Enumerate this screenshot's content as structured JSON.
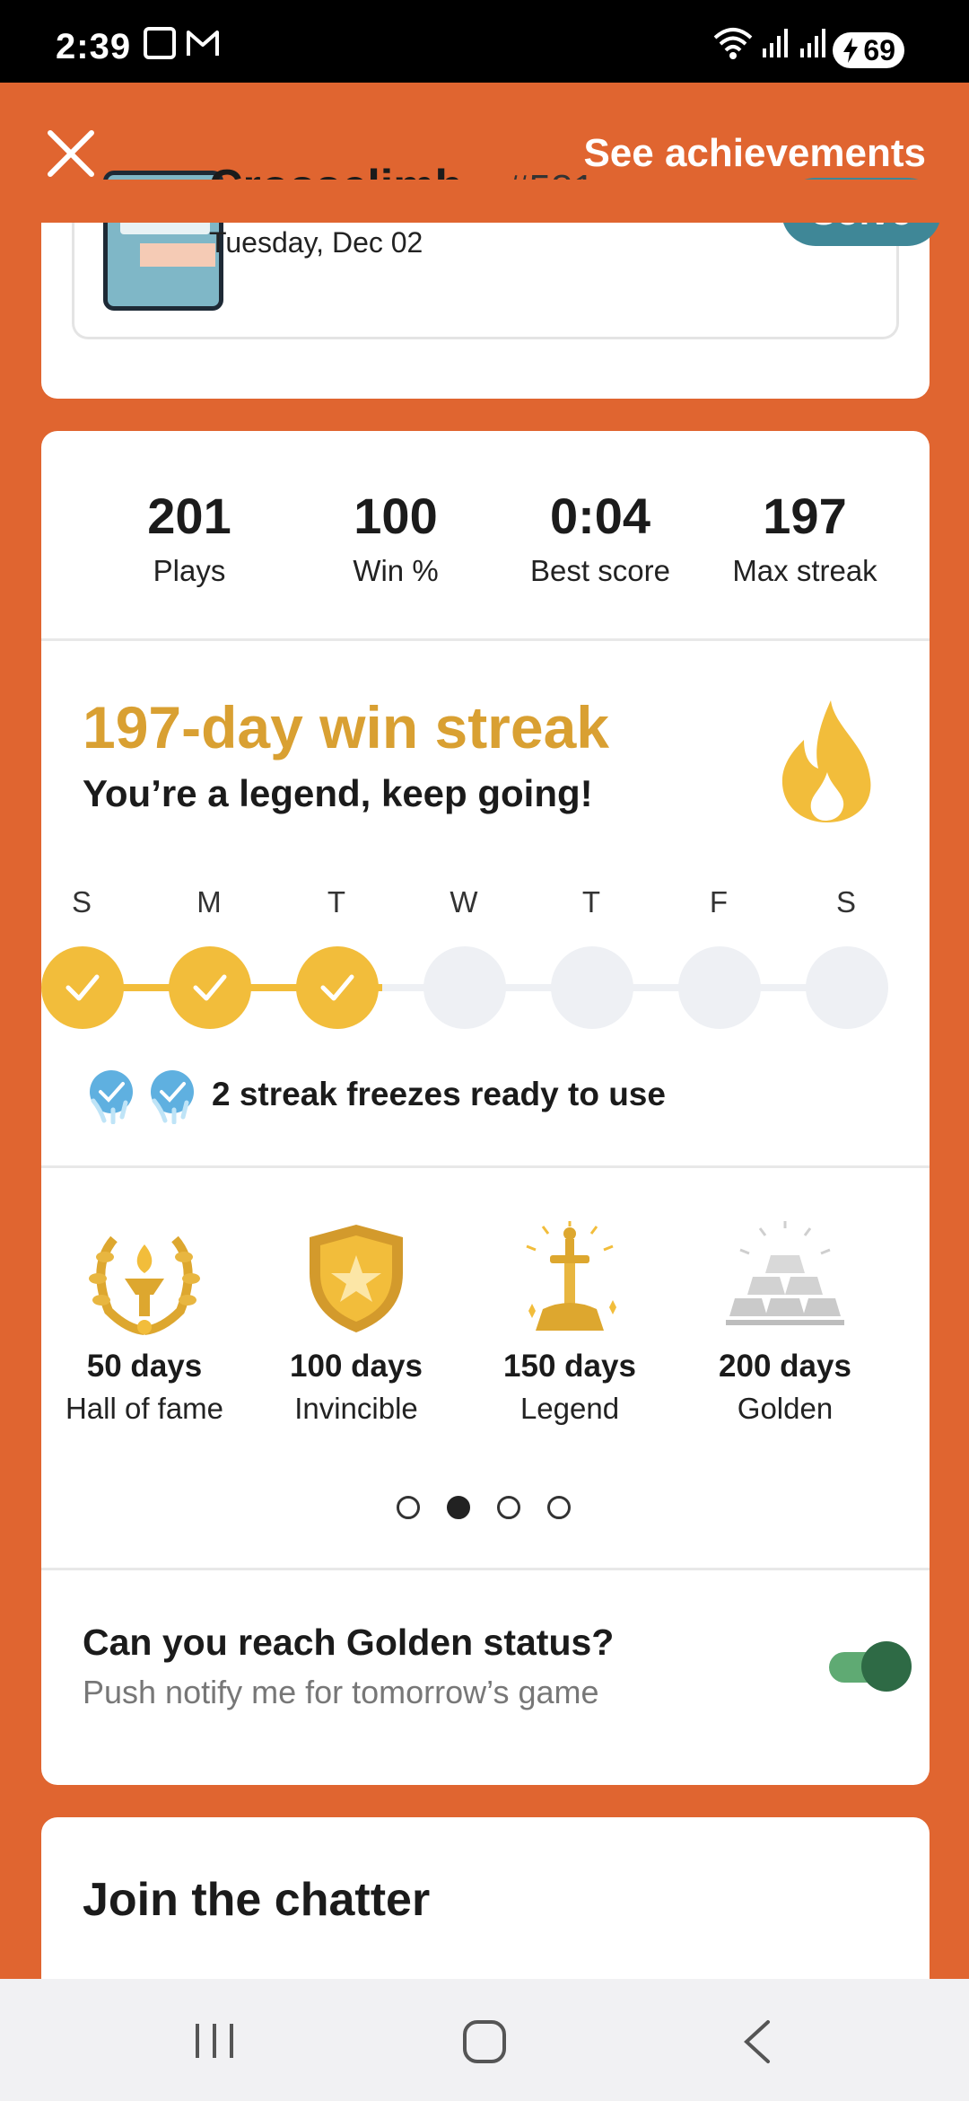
{
  "status_bar": {
    "time": "2:39",
    "battery": "69"
  },
  "header": {
    "see_achievements": "See achievements"
  },
  "puzzle": {
    "name": "Crossclimb",
    "number": "#581",
    "date": "Tuesday, Dec 02",
    "solve_label": "Solve"
  },
  "stats": [
    {
      "value": "201",
      "label": "Plays"
    },
    {
      "value": "100",
      "label": "Win %"
    },
    {
      "value": "0:04",
      "label": "Best score"
    },
    {
      "value": "197",
      "label": "Max streak"
    }
  ],
  "streak": {
    "title": "197-day win streak",
    "subtitle": "You’re a legend, keep going!",
    "days": [
      {
        "letter": "S",
        "done": true
      },
      {
        "letter": "M",
        "done": true
      },
      {
        "letter": "T",
        "done": true
      },
      {
        "letter": "W",
        "done": false
      },
      {
        "letter": "T",
        "done": false
      },
      {
        "letter": "F",
        "done": false
      },
      {
        "letter": "S",
        "done": false
      }
    ],
    "freezes_text": "2 streak freezes ready to use",
    "accent_color": "#F2BD3B"
  },
  "badges": [
    {
      "days": "50 days",
      "name": "Hall of fame",
      "icon": "laurel-torch-icon"
    },
    {
      "days": "100 days",
      "name": "Invincible",
      "icon": "shield-star-icon"
    },
    {
      "days": "150 days",
      "name": "Legend",
      "icon": "sword-stone-icon"
    },
    {
      "days": "200 days",
      "name": "Golden",
      "icon": "gold-bars-icon"
    }
  ],
  "pager": {
    "count": 4,
    "active_index": 1
  },
  "notify": {
    "question": "Can you reach Golden status?",
    "subtitle": "Push notify me for tomorrow’s game",
    "enabled": true
  },
  "chatter": {
    "title": "Join the chatter"
  },
  "colors": {
    "brand_orange": "#E06530",
    "solve_teal": "#3f8797",
    "streak_gold": "#D9A032"
  }
}
